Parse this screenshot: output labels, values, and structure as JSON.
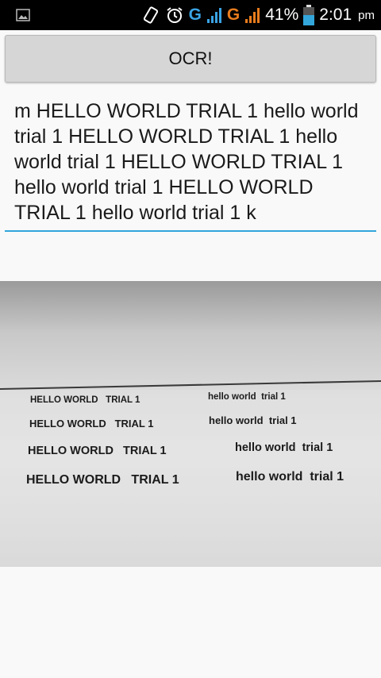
{
  "status_bar": {
    "icons": [
      "image-notification-icon",
      "vibrate-icon",
      "alarm-icon",
      "signal-g-icon",
      "signal-g-icon-2",
      "battery-icon"
    ],
    "net1": "G",
    "net2": "G",
    "battery_percent": "41%",
    "time": "2:01",
    "ampm": "pm",
    "colors": {
      "net1": "#3aa3e3",
      "net2": "#e87c1e"
    }
  },
  "ocr_button": {
    "label": "OCR!"
  },
  "ocr_result": {
    "text": "m HELLO WORLD TRIAL 1 hello world trial 1 HELLO WORLD TRIAL 1 hello world trial 1 HELLO WORLD TRIAL 1 hello world trial 1 HELLO WORLD TRIAL 1 hello world trial 1 k",
    "underline_color": "#33a6db"
  },
  "photo": {
    "rows": [
      {
        "left": "HELLO WORLD   TRIAL 1",
        "right": "hello world  trial 1"
      },
      {
        "left": "HELLO WORLD   TRIAL 1",
        "right": "hello world  trial 1"
      },
      {
        "left": "HELLO WORLD   TRIAL 1",
        "right": "hello world  trial 1"
      },
      {
        "left": "HELLO WORLD   TRIAL 1",
        "right": "hello world  trial 1"
      }
    ]
  }
}
